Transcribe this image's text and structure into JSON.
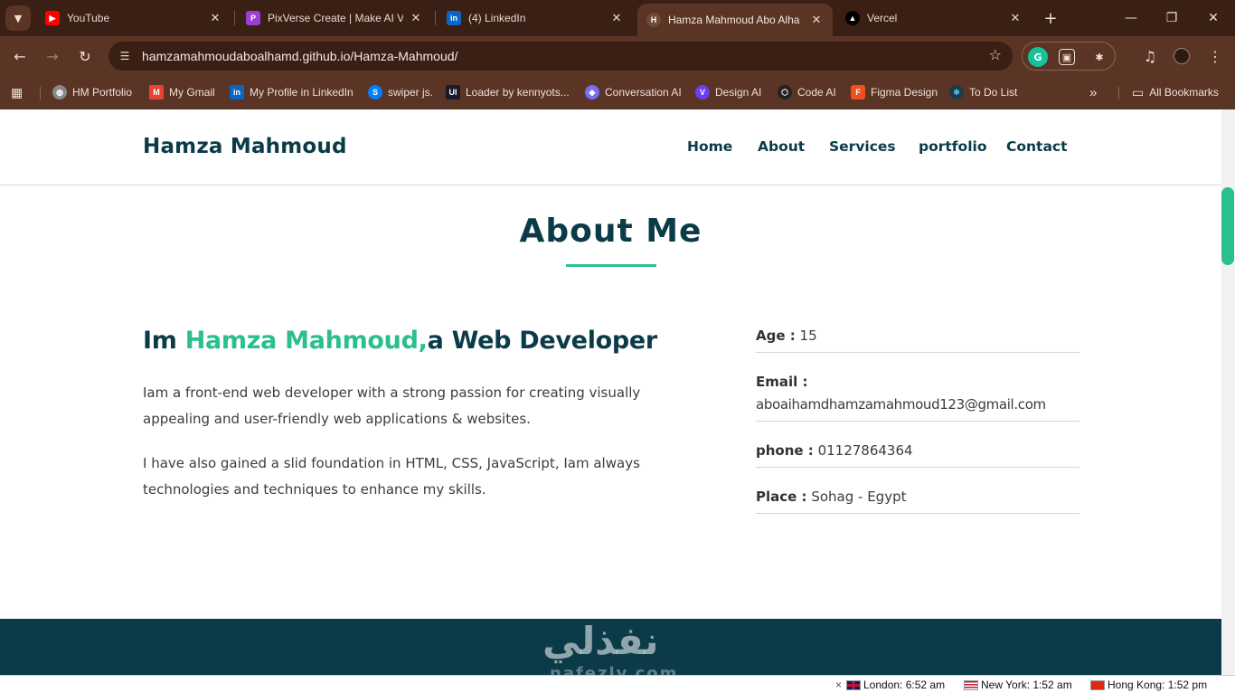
{
  "browser": {
    "tabs": [
      {
        "title": "YouTube",
        "close": "✕"
      },
      {
        "title": "PixVerse Create | Make AI Vid",
        "close": "✕"
      },
      {
        "title": "(4) LinkedIn",
        "close": "✕"
      },
      {
        "title": "Hamza Mahmoud Abo Alha",
        "close": "✕"
      },
      {
        "title": "Vercel",
        "close": "✕"
      }
    ],
    "new_tab": "+",
    "url": "hamzamahmoudaboalhamd.github.io/Hamza-Mahmoud/",
    "bookmarks": [
      "HM Portfolio",
      "My Gmail",
      "My Profile in LinkedIn",
      "swiper js.",
      "Loader by kennyots...",
      "Conversation AI",
      "Design AI",
      "Code AI",
      "Figma Design",
      "To Do List"
    ],
    "bookmarks_more": "»",
    "all_bookmarks": "All Bookmarks"
  },
  "site": {
    "logo": "Hamza Mahmoud",
    "nav": [
      "Home",
      "About",
      "Services",
      "portfolio",
      "Contact"
    ],
    "section_title": "About Me",
    "intro": {
      "prefix": "Im ",
      "name": "Hamza Mahmoud,",
      "suffix": "a Web Developer"
    },
    "paragraphs": [
      "Iam a front-end web developer with a strong passion for creating visually appealing and user-friendly web applications & websites.",
      "I have also gained a slid foundation in HTML, CSS, JavaScript, Iam always technologies and techniques to enhance my skills."
    ],
    "info": [
      {
        "key": "Age :",
        "value": "15"
      },
      {
        "key": "Email :",
        "value": "aboaihamdhamzamahmoud123@gmail.com"
      },
      {
        "key": "phone :",
        "value": "01127864364"
      },
      {
        "key": "Place :",
        "value": "Sohag - Egypt"
      }
    ],
    "watermark_ar": "نفذلي",
    "watermark_en": "nafezly.com"
  },
  "clocks": [
    {
      "text": "London: 6:52 am"
    },
    {
      "text": "New York: 1:52 am"
    },
    {
      "text": "Hong Kong: 1:52 pm"
    }
  ],
  "clocks_close": "×",
  "colors": {
    "accent": "#2bbf8e",
    "brand_dark": "#0b3b48",
    "chrome_dark": "#3a1f14",
    "chrome_mid": "#5a3424"
  },
  "icons": {
    "tab_search": "chevron-down-icon",
    "back": "arrow-left-icon",
    "forward": "arrow-right-icon",
    "reload": "reload-icon",
    "site_info": "tune-icon",
    "bookmark_star": "star-icon",
    "extensions": "puzzle-icon",
    "media": "media-control-icon",
    "profile": "avatar",
    "menu": "kebab-menu-icon"
  }
}
